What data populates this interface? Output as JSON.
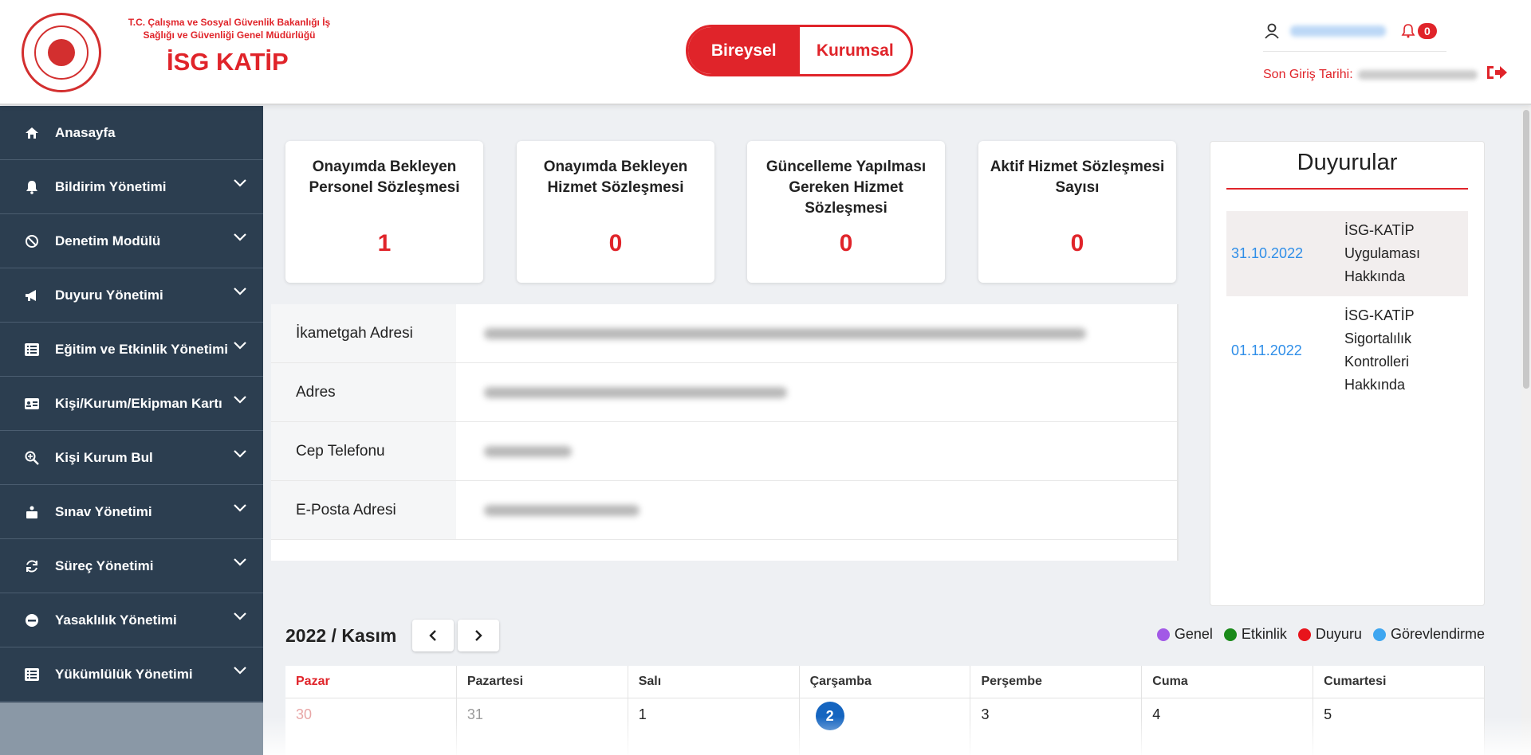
{
  "header": {
    "ministry_line1": "T.C. Çalışma ve Sosyal Güvenlik Bakanlığı İş",
    "ministry_line2": "Sağlığı ve Güvenliği Genel Müdürlüğü",
    "app_title": "İSG KATİP",
    "toggle": [
      "Bireysel",
      "Kurumsal"
    ],
    "notification_count": "0",
    "last_login_label": "Son Giriş Tarihi:"
  },
  "sidebar": {
    "items": [
      {
        "label": "Anasayfa",
        "icon": "home-icon"
      },
      {
        "label": "Bildirim Yönetimi",
        "icon": "bell-icon"
      },
      {
        "label": "Denetim Modülü",
        "icon": "ban-icon"
      },
      {
        "label": "Duyuru Yönetimi",
        "icon": "megaphone-icon"
      },
      {
        "label": "Eğitim ve Etkinlik Yönetimi",
        "icon": "list-icon"
      },
      {
        "label": "Kişi/Kurum/Ekipman Kartı",
        "icon": "id-card-icon"
      },
      {
        "label": "Kişi Kurum Bul",
        "icon": "search-icon"
      },
      {
        "label": "Sınav Yönetimi",
        "icon": "exam-icon"
      },
      {
        "label": "Süreç Yönetimi",
        "icon": "sync-icon"
      },
      {
        "label": "Yasaklılık Yönetimi",
        "icon": "minus-circle-icon"
      },
      {
        "label": "Yükümlülük Yönetimi",
        "icon": "list-icon"
      }
    ]
  },
  "stats": [
    {
      "label": "Onayımda Bekleyen Personel Sözleşmesi",
      "value": "1"
    },
    {
      "label": "Onayımda Bekleyen Hizmet Sözleşmesi",
      "value": "0"
    },
    {
      "label": "Güncelleme Yapılması Gereken Hizmet Sözleşmesi",
      "value": "0"
    },
    {
      "label": "Aktif Hizmet Sözleşmesi Sayısı",
      "value": "0"
    }
  ],
  "info": {
    "rows": [
      {
        "label": "İkametgah Adresi"
      },
      {
        "label": "Adres"
      },
      {
        "label": "Cep Telefonu"
      },
      {
        "label": "E-Posta Adresi"
      }
    ]
  },
  "announcements": {
    "title": "Duyurular",
    "items": [
      {
        "date": "31.10.2022",
        "text_lines": [
          "İSG-KATİP",
          "Uygulaması",
          "Hakkında"
        ]
      },
      {
        "date": "01.11.2022",
        "text_lines": [
          "İSG-KATİP",
          "Sigortalılık",
          "Kontrolleri",
          "Hakkında"
        ]
      }
    ]
  },
  "calendar": {
    "title": "2022 / Kasım",
    "legend": [
      {
        "label": "Genel",
        "color": "#a259e6"
      },
      {
        "label": "Etkinlik",
        "color": "#1a8a1a"
      },
      {
        "label": "Duyuru",
        "color": "#e8141c"
      },
      {
        "label": "Görevlendirme",
        "color": "#3ea6f0"
      }
    ],
    "days": [
      "Pazar",
      "Pazartesi",
      "Salı",
      "Çarşamba",
      "Perşembe",
      "Cuma",
      "Cumartesi"
    ],
    "week1": [
      "30",
      "31",
      "1",
      "2",
      "3",
      "4",
      "5"
    ]
  },
  "colors": {
    "accent": "#e0242a",
    "sidebar": "#2c3e50",
    "link": "#2f8ee8"
  }
}
